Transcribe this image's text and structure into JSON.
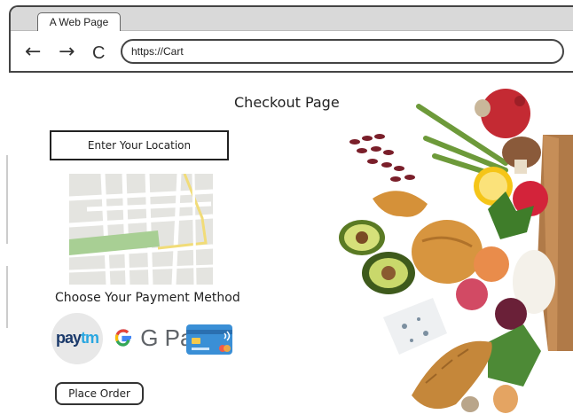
{
  "browser": {
    "tab_title": "A Web Page",
    "url": "https://Cart",
    "back_icon": "←",
    "forward_icon": "→",
    "reload_icon": "C"
  },
  "page": {
    "title": "Checkout Page",
    "location_button": "Enter Your Location",
    "payment_heading": "Choose Your Payment Method",
    "payment_methods": {
      "paytm_pay": "pay",
      "paytm_tm": "tm",
      "gpay": "G Pay",
      "card": "card"
    },
    "place_order": "Place Order"
  },
  "colors": {
    "paytm_dark": "#1b3a6b",
    "paytm_light": "#2aa7e0",
    "google_blue": "#4285F4",
    "google_red": "#EA4335",
    "google_yellow": "#FBBC05",
    "google_green": "#34A853",
    "card_blue": "#3a8fd6"
  }
}
